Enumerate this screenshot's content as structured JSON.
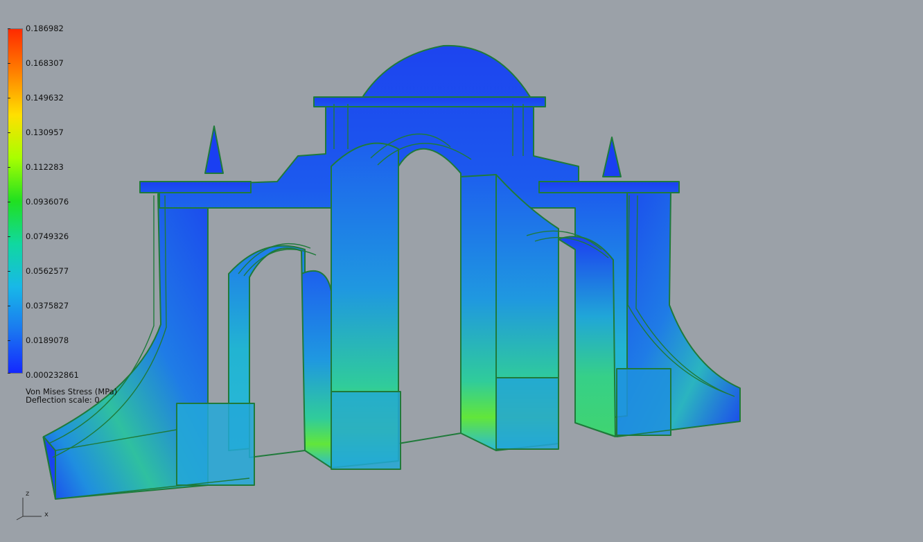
{
  "legend": {
    "ticks": [
      "0.186982",
      "0.168307",
      "0.149632",
      "0.130957",
      "0.112283",
      "0.0936076",
      "0.0749326",
      "0.0562577",
      "0.0375827",
      "0.0189078",
      "0.000232861"
    ],
    "gradient_colors": [
      "#ff2a00",
      "#ff8000",
      "#ffe000",
      "#a8ff00",
      "#20e020",
      "#10d8a0",
      "#18b8e8",
      "#1a78f0",
      "#1428ff"
    ],
    "quantity_label": "Von Mises Stress (MPa)",
    "deflection_label": "Deflection scale: 0"
  },
  "axes": {
    "z_label": "z",
    "x_label": "x"
  },
  "colors": {
    "background": "#9ba1a8",
    "edge": "#1f7a3a",
    "stress_low": "#1a3ff2",
    "stress_mid": "#2cc0c0",
    "stress_high": "#5fe830"
  }
}
